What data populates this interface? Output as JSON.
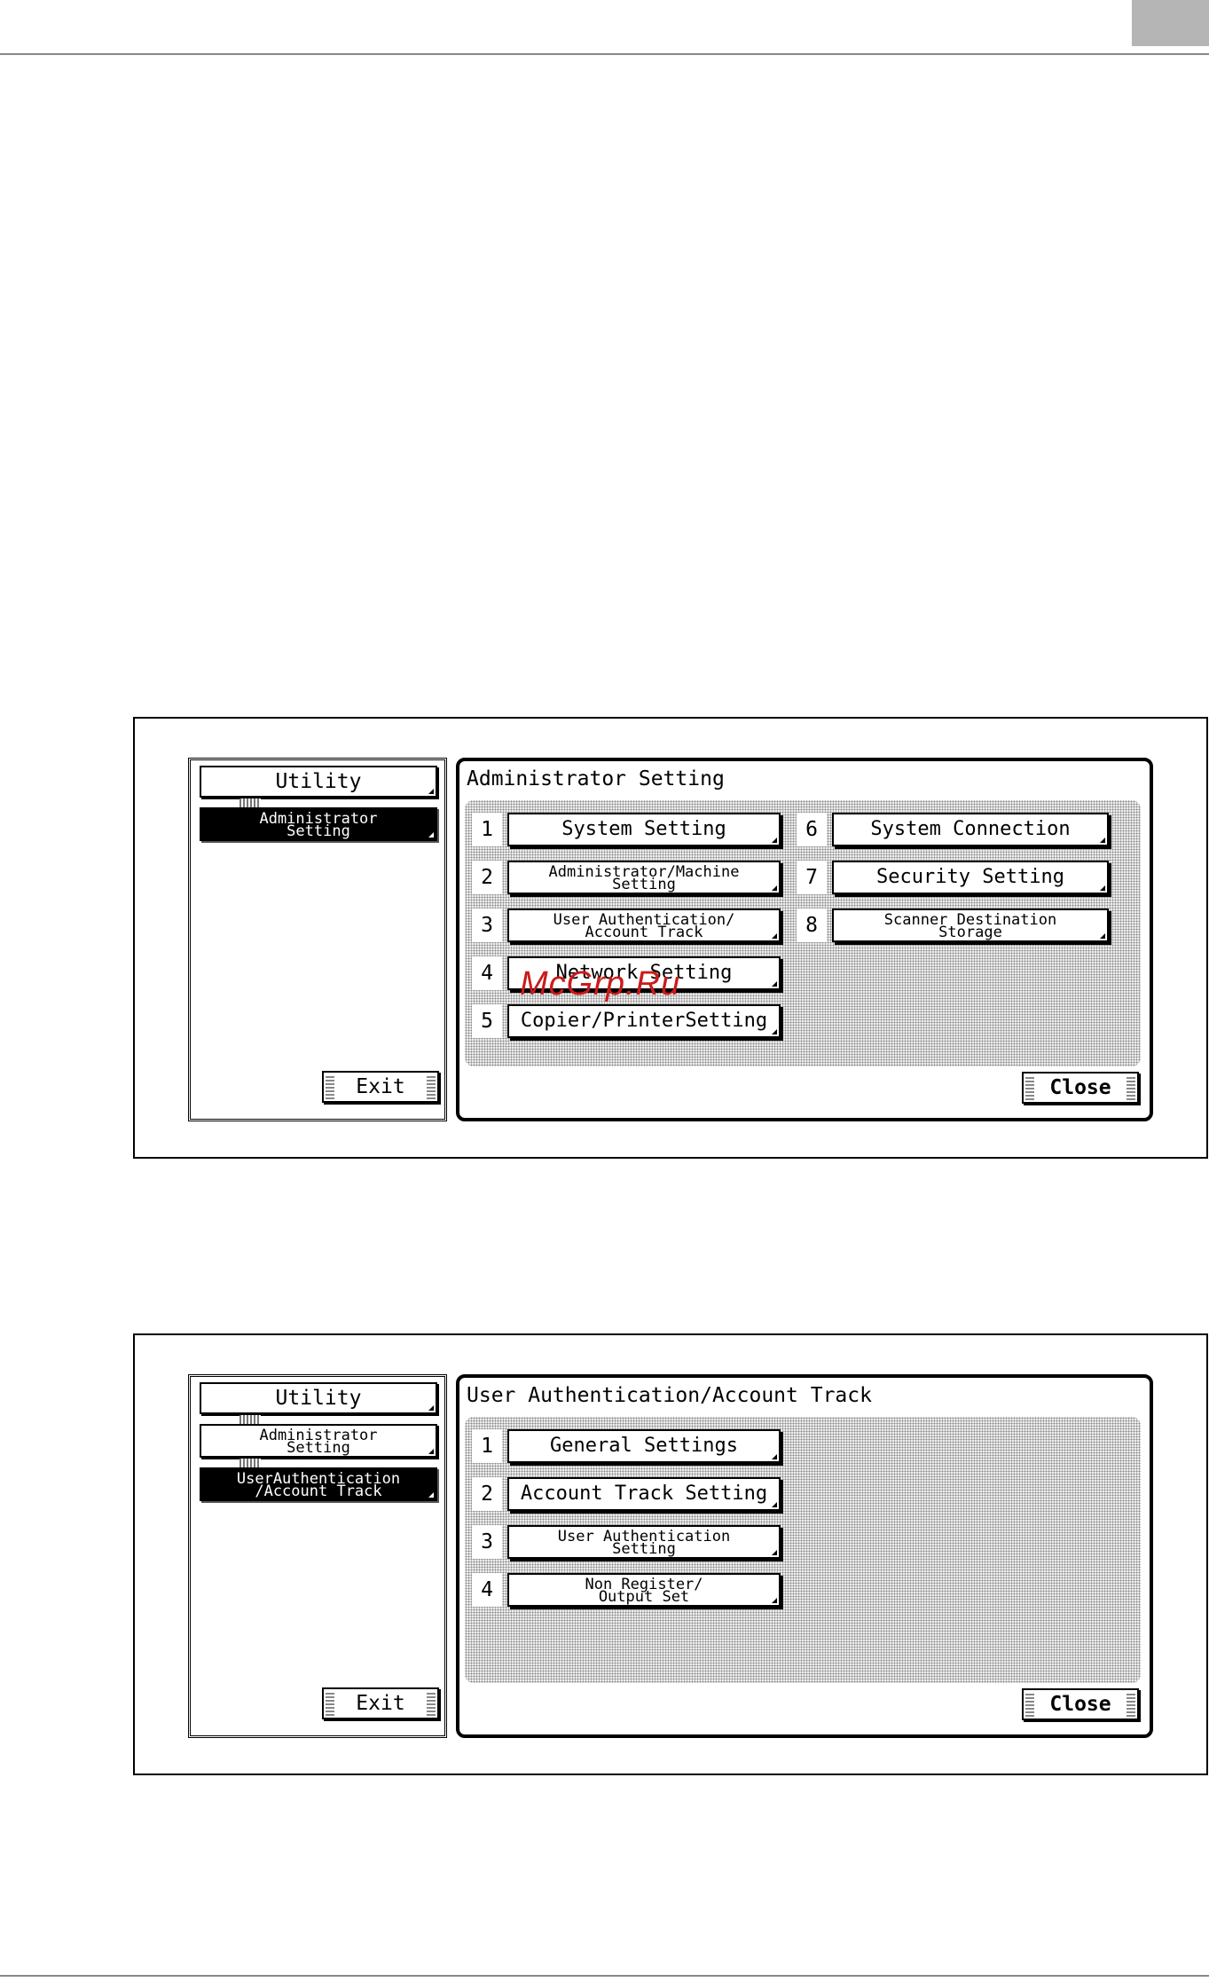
{
  "watermark": "McGrp.Ru",
  "screen1": {
    "nav": {
      "utility": "Utility",
      "admin": "Administrator\nSetting",
      "exit": "Exit"
    },
    "title": "Administrator Setting",
    "close": "Close",
    "options": [
      {
        "num": "1",
        "label": "System Setting"
      },
      {
        "num": "2",
        "label": "Administrator/Machine\nSetting"
      },
      {
        "num": "3",
        "label": "User Authentication/\nAccount Track"
      },
      {
        "num": "4",
        "label": "Network Setting"
      },
      {
        "num": "5",
        "label": "Copier/PrinterSetting"
      },
      {
        "num": "6",
        "label": "System Connection"
      },
      {
        "num": "7",
        "label": "Security Setting"
      },
      {
        "num": "8",
        "label": "Scanner Destination\nStorage"
      }
    ]
  },
  "screen2": {
    "nav": {
      "utility": "Utility",
      "admin": "Administrator\nSetting",
      "user_auth": "UserAuthentication\n/Account Track",
      "exit": "Exit"
    },
    "title": "User Authentication/Account Track",
    "close": "Close",
    "options": [
      {
        "num": "1",
        "label": "General Settings"
      },
      {
        "num": "2",
        "label": "Account Track Setting"
      },
      {
        "num": "3",
        "label": "User Authentication\nSetting"
      },
      {
        "num": "4",
        "label": "Non Register/\nOutput Set"
      }
    ]
  }
}
